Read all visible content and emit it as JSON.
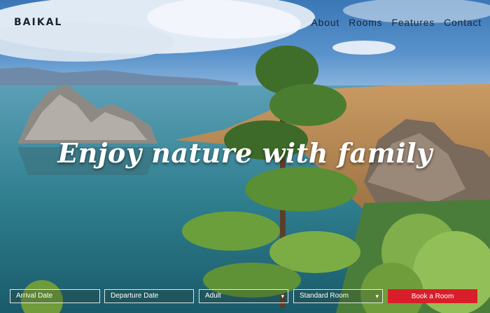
{
  "brand": {
    "name": "BAIKAL"
  },
  "nav": {
    "items": [
      {
        "label": "About"
      },
      {
        "label": "Rooms"
      },
      {
        "label": "Features"
      },
      {
        "label": "Contact"
      }
    ]
  },
  "hero": {
    "headline": "Enjoy nature with family"
  },
  "booking": {
    "arrival_placeholder": "Arrival Date",
    "departure_placeholder": "Departure Date",
    "guests_value": "Adult",
    "room_value": "Standard Room",
    "submit_label": "Book a Room"
  },
  "colors": {
    "accent": "#d81e2a",
    "sky": "#3f7fc0",
    "water": "#2f7f8f"
  },
  "icons": {
    "dropdown": "chevron-down-icon"
  }
}
